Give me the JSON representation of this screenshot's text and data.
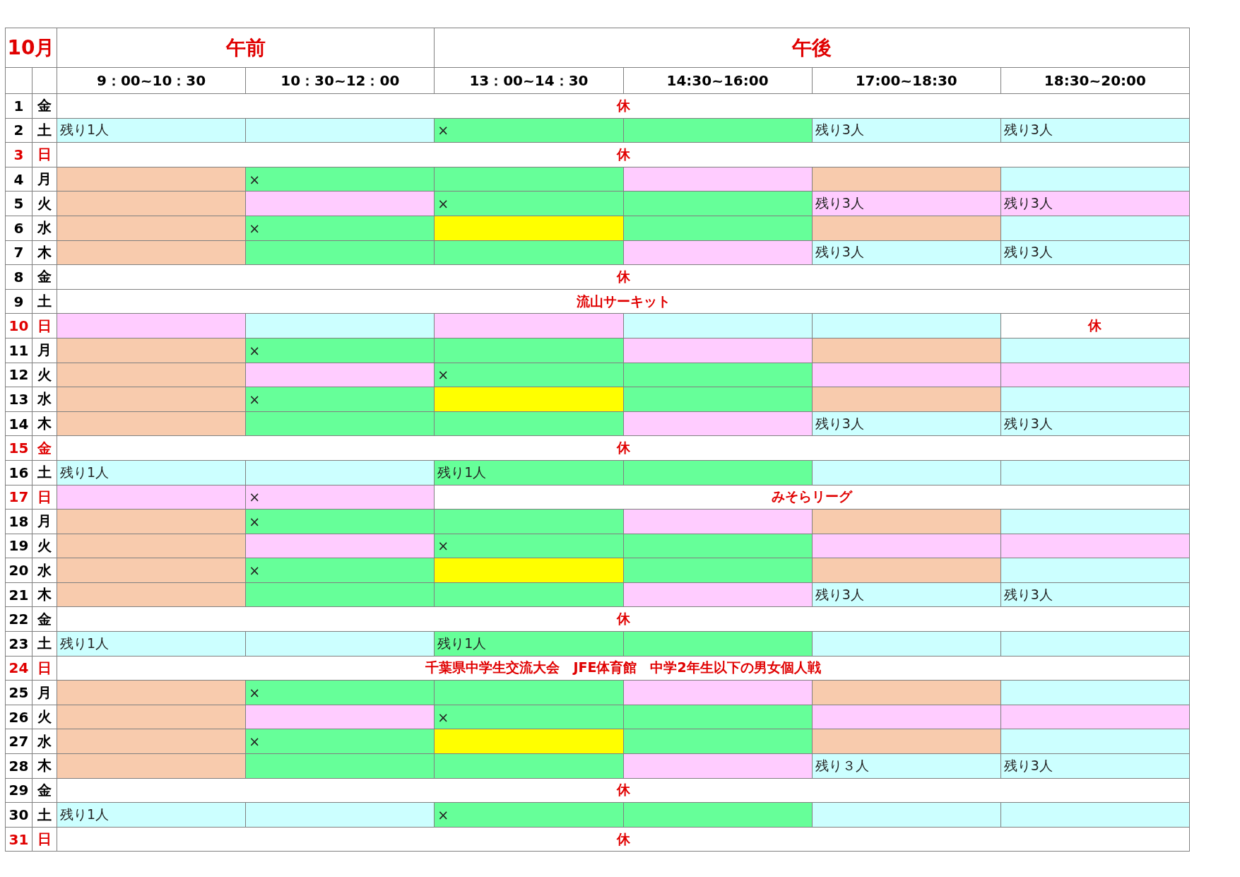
{
  "month": "10月",
  "periods": [
    {
      "label": "午前",
      "slots": [
        "9：00~10：30",
        "10：30~12：00"
      ]
    },
    {
      "label": "午後",
      "slots": [
        "13：00~14：30",
        "14:30~16:00",
        "17:00~18:30",
        "18:30~20:00"
      ]
    }
  ],
  "rows": [
    {
      "day": "1",
      "dow": "金",
      "red": false,
      "cells": [
        {
          "kind": "event",
          "text": "休"
        }
      ]
    },
    {
      "day": "2",
      "dow": "土",
      "red": false,
      "cells": [
        {
          "kind": "slot",
          "color": "#ccffff",
          "text": "残り1人"
        },
        {
          "kind": "slot",
          "color": "#ccffff"
        },
        {
          "kind": "slot",
          "color": "#66ff99",
          "text": "×"
        },
        {
          "kind": "slot",
          "color": "#66ff99"
        },
        {
          "kind": "slot",
          "color": "#ccffff",
          "text": "残り3人"
        },
        {
          "kind": "slot",
          "color": "#ccffff",
          "text": "残り3人"
        }
      ]
    },
    {
      "day": "3",
      "dow": "日",
      "red": true,
      "cells": [
        {
          "kind": "event",
          "text": "休"
        }
      ]
    },
    {
      "day": "4",
      "dow": "月",
      "red": false,
      "cells": [
        {
          "kind": "slot",
          "color": "#f8cbad"
        },
        {
          "kind": "slot",
          "color": "#66ff99",
          "text": "×"
        },
        {
          "kind": "slot",
          "color": "#66ff99"
        },
        {
          "kind": "slot",
          "color": "#ffccff"
        },
        {
          "kind": "slot",
          "color": "#f8cbad"
        },
        {
          "kind": "slot",
          "color": "#ccffff"
        }
      ]
    },
    {
      "day": "5",
      "dow": "火",
      "red": false,
      "cells": [
        {
          "kind": "slot",
          "color": "#f8cbad"
        },
        {
          "kind": "slot",
          "color": "#ffccff"
        },
        {
          "kind": "slot",
          "color": "#66ff99",
          "text": "×"
        },
        {
          "kind": "slot",
          "color": "#66ff99"
        },
        {
          "kind": "slot",
          "color": "#ffccff",
          "text": "残り3人"
        },
        {
          "kind": "slot",
          "color": "#ffccff",
          "text": "残り3人"
        }
      ]
    },
    {
      "day": "6",
      "dow": "水",
      "red": false,
      "cells": [
        {
          "kind": "slot",
          "color": "#f8cbad"
        },
        {
          "kind": "slot",
          "color": "#66ff99",
          "text": "×"
        },
        {
          "kind": "slot",
          "color": "#ffff00"
        },
        {
          "kind": "slot",
          "color": "#66ff99"
        },
        {
          "kind": "slot",
          "color": "#f8cbad"
        },
        {
          "kind": "slot",
          "color": "#ccffff"
        }
      ]
    },
    {
      "day": "7",
      "dow": "木",
      "red": false,
      "cells": [
        {
          "kind": "slot",
          "color": "#f8cbad"
        },
        {
          "kind": "slot",
          "color": "#66ff99"
        },
        {
          "kind": "slot",
          "color": "#66ff99"
        },
        {
          "kind": "slot",
          "color": "#ffccff"
        },
        {
          "kind": "slot",
          "color": "#ccffff",
          "text": "残り3人"
        },
        {
          "kind": "slot",
          "color": "#ccffff",
          "text": "残り3人"
        }
      ]
    },
    {
      "day": "8",
      "dow": "金",
      "red": false,
      "cells": [
        {
          "kind": "event",
          "text": "休"
        }
      ]
    },
    {
      "day": "9",
      "dow": "土",
      "red": false,
      "cells": [
        {
          "kind": "event",
          "text": "流山サーキット"
        }
      ]
    },
    {
      "day": "10",
      "dow": "日",
      "red": true,
      "cells": [
        {
          "kind": "slot",
          "color": "#ffccff"
        },
        {
          "kind": "slot",
          "color": "#ccffff"
        },
        {
          "kind": "slot",
          "color": "#ffccff"
        },
        {
          "kind": "slot",
          "color": "#ccffff"
        },
        {
          "kind": "slot",
          "color": "#ccffff"
        },
        {
          "kind": "event",
          "text": "休"
        }
      ]
    },
    {
      "day": "11",
      "dow": "月",
      "red": false,
      "cells": [
        {
          "kind": "slot",
          "color": "#f8cbad"
        },
        {
          "kind": "slot",
          "color": "#66ff99",
          "text": "×"
        },
        {
          "kind": "slot",
          "color": "#66ff99"
        },
        {
          "kind": "slot",
          "color": "#ffccff"
        },
        {
          "kind": "slot",
          "color": "#f8cbad"
        },
        {
          "kind": "slot",
          "color": "#ccffff"
        }
      ]
    },
    {
      "day": "12",
      "dow": "火",
      "red": false,
      "cells": [
        {
          "kind": "slot",
          "color": "#f8cbad"
        },
        {
          "kind": "slot",
          "color": "#ffccff"
        },
        {
          "kind": "slot",
          "color": "#66ff99",
          "text": "×"
        },
        {
          "kind": "slot",
          "color": "#66ff99"
        },
        {
          "kind": "slot",
          "color": "#ffccff"
        },
        {
          "kind": "slot",
          "color": "#ffccff"
        }
      ]
    },
    {
      "day": "13",
      "dow": "水",
      "red": false,
      "cells": [
        {
          "kind": "slot",
          "color": "#f8cbad"
        },
        {
          "kind": "slot",
          "color": "#66ff99",
          "text": "×"
        },
        {
          "kind": "slot",
          "color": "#ffff00"
        },
        {
          "kind": "slot",
          "color": "#66ff99"
        },
        {
          "kind": "slot",
          "color": "#f8cbad"
        },
        {
          "kind": "slot",
          "color": "#ccffff"
        }
      ]
    },
    {
      "day": "14",
      "dow": "木",
      "red": false,
      "cells": [
        {
          "kind": "slot",
          "color": "#f8cbad"
        },
        {
          "kind": "slot",
          "color": "#66ff99"
        },
        {
          "kind": "slot",
          "color": "#66ff99"
        },
        {
          "kind": "slot",
          "color": "#ffccff"
        },
        {
          "kind": "slot",
          "color": "#ccffff",
          "text": "残り3人"
        },
        {
          "kind": "slot",
          "color": "#ccffff",
          "text": "残り3人"
        }
      ]
    },
    {
      "day": "15",
      "dow": "金",
      "red": true,
      "cells": [
        {
          "kind": "event",
          "text": "休"
        }
      ]
    },
    {
      "day": "16",
      "dow": "土",
      "red": false,
      "cells": [
        {
          "kind": "slot",
          "color": "#ccffff",
          "text": "残り1人"
        },
        {
          "kind": "slot",
          "color": "#ccffff"
        },
        {
          "kind": "slot",
          "color": "#66ff99",
          "text": "残り1人"
        },
        {
          "kind": "slot",
          "color": "#66ff99"
        },
        {
          "kind": "slot",
          "color": "#ccffff"
        },
        {
          "kind": "slot",
          "color": "#ccffff"
        }
      ]
    },
    {
      "day": "17",
      "dow": "日",
      "red": true,
      "cells": [
        {
          "kind": "slot",
          "color": "#ffccff"
        },
        {
          "kind": "slot",
          "color": "#ffccff",
          "text": "×"
        },
        {
          "kind": "event",
          "text": "みそらリーグ"
        }
      ]
    },
    {
      "day": "18",
      "dow": "月",
      "red": false,
      "cells": [
        {
          "kind": "slot",
          "color": "#f8cbad"
        },
        {
          "kind": "slot",
          "color": "#66ff99",
          "text": "×"
        },
        {
          "kind": "slot",
          "color": "#66ff99"
        },
        {
          "kind": "slot",
          "color": "#ffccff"
        },
        {
          "kind": "slot",
          "color": "#f8cbad"
        },
        {
          "kind": "slot",
          "color": "#ccffff"
        }
      ]
    },
    {
      "day": "19",
      "dow": "火",
      "red": false,
      "cells": [
        {
          "kind": "slot",
          "color": "#f8cbad"
        },
        {
          "kind": "slot",
          "color": "#ffccff"
        },
        {
          "kind": "slot",
          "color": "#66ff99",
          "text": "×"
        },
        {
          "kind": "slot",
          "color": "#66ff99"
        },
        {
          "kind": "slot",
          "color": "#ffccff"
        },
        {
          "kind": "slot",
          "color": "#ffccff"
        }
      ]
    },
    {
      "day": "20",
      "dow": "水",
      "red": false,
      "cells": [
        {
          "kind": "slot",
          "color": "#f8cbad"
        },
        {
          "kind": "slot",
          "color": "#66ff99",
          "text": "×"
        },
        {
          "kind": "slot",
          "color": "#ffff00"
        },
        {
          "kind": "slot",
          "color": "#66ff99"
        },
        {
          "kind": "slot",
          "color": "#f8cbad"
        },
        {
          "kind": "slot",
          "color": "#ccffff"
        }
      ]
    },
    {
      "day": "21",
      "dow": "木",
      "red": false,
      "cells": [
        {
          "kind": "slot",
          "color": "#f8cbad"
        },
        {
          "kind": "slot",
          "color": "#66ff99"
        },
        {
          "kind": "slot",
          "color": "#66ff99"
        },
        {
          "kind": "slot",
          "color": "#ffccff"
        },
        {
          "kind": "slot",
          "color": "#ccffff",
          "text": "残り3人"
        },
        {
          "kind": "slot",
          "color": "#ccffff",
          "text": "残り3人"
        }
      ]
    },
    {
      "day": "22",
      "dow": "金",
      "red": false,
      "cells": [
        {
          "kind": "event",
          "text": "休"
        }
      ]
    },
    {
      "day": "23",
      "dow": "土",
      "red": false,
      "cells": [
        {
          "kind": "slot",
          "color": "#ccffff",
          "text": "残り1人"
        },
        {
          "kind": "slot",
          "color": "#ccffff"
        },
        {
          "kind": "slot",
          "color": "#66ff99",
          "text": "残り1人"
        },
        {
          "kind": "slot",
          "color": "#66ff99"
        },
        {
          "kind": "slot",
          "color": "#ccffff"
        },
        {
          "kind": "slot",
          "color": "#ccffff"
        }
      ]
    },
    {
      "day": "24",
      "dow": "日",
      "red": true,
      "cells": [
        {
          "kind": "event",
          "text": "千葉県中学生交流大会　JFE体育館　中学2年生以下の男女個人戦"
        }
      ]
    },
    {
      "day": "25",
      "dow": "月",
      "red": false,
      "cells": [
        {
          "kind": "slot",
          "color": "#f8cbad"
        },
        {
          "kind": "slot",
          "color": "#66ff99",
          "text": "×"
        },
        {
          "kind": "slot",
          "color": "#66ff99"
        },
        {
          "kind": "slot",
          "color": "#ffccff"
        },
        {
          "kind": "slot",
          "color": "#f8cbad"
        },
        {
          "kind": "slot",
          "color": "#ccffff"
        }
      ]
    },
    {
      "day": "26",
      "dow": "火",
      "red": false,
      "cells": [
        {
          "kind": "slot",
          "color": "#f8cbad"
        },
        {
          "kind": "slot",
          "color": "#ffccff"
        },
        {
          "kind": "slot",
          "color": "#66ff99",
          "text": "×"
        },
        {
          "kind": "slot",
          "color": "#66ff99"
        },
        {
          "kind": "slot",
          "color": "#ffccff"
        },
        {
          "kind": "slot",
          "color": "#ffccff"
        }
      ]
    },
    {
      "day": "27",
      "dow": "水",
      "red": false,
      "cells": [
        {
          "kind": "slot",
          "color": "#f8cbad"
        },
        {
          "kind": "slot",
          "color": "#66ff99",
          "text": "×"
        },
        {
          "kind": "slot",
          "color": "#ffff00"
        },
        {
          "kind": "slot",
          "color": "#66ff99"
        },
        {
          "kind": "slot",
          "color": "#f8cbad"
        },
        {
          "kind": "slot",
          "color": "#ccffff"
        }
      ]
    },
    {
      "day": "28",
      "dow": "木",
      "red": false,
      "cells": [
        {
          "kind": "slot",
          "color": "#f8cbad"
        },
        {
          "kind": "slot",
          "color": "#66ff99"
        },
        {
          "kind": "slot",
          "color": "#66ff99"
        },
        {
          "kind": "slot",
          "color": "#ffccff"
        },
        {
          "kind": "slot",
          "color": "#ccffff",
          "text": "残り３人"
        },
        {
          "kind": "slot",
          "color": "#ccffff",
          "text": "残り3人"
        }
      ]
    },
    {
      "day": "29",
      "dow": "金",
      "red": false,
      "cells": [
        {
          "kind": "event",
          "text": "休"
        }
      ]
    },
    {
      "day": "30",
      "dow": "土",
      "red": false,
      "cells": [
        {
          "kind": "slot",
          "color": "#ccffff",
          "text": "残り1人"
        },
        {
          "kind": "slot",
          "color": "#ccffff"
        },
        {
          "kind": "slot",
          "color": "#66ff99",
          "text": "×"
        },
        {
          "kind": "slot",
          "color": "#66ff99"
        },
        {
          "kind": "slot",
          "color": "#ccffff"
        },
        {
          "kind": "slot",
          "color": "#ccffff"
        }
      ]
    },
    {
      "day": "31",
      "dow": "日",
      "red": true,
      "cells": [
        {
          "kind": "event",
          "text": "休"
        }
      ]
    }
  ]
}
